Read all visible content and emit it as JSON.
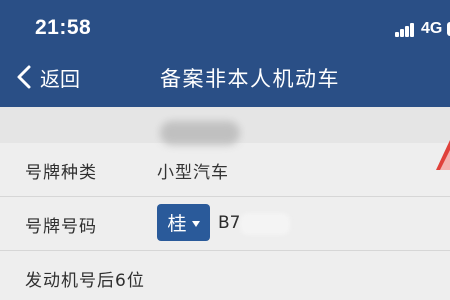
{
  "status_bar": {
    "time": "21:58",
    "network": "4G"
  },
  "nav": {
    "back_label": "返回",
    "title": "备案非本人机动车"
  },
  "form": {
    "plate_type": {
      "label": "号牌种类",
      "value": "小型汽车"
    },
    "plate_number": {
      "label": "号牌号码",
      "province": "桂",
      "value": "B7"
    },
    "engine_last6": {
      "label": "发动机号后6位"
    }
  },
  "colors": {
    "header_bg": "#2a4f86",
    "province_button_bg": "#2a5a9a",
    "page_bg": "#eeeeee",
    "accent_red": "#e0413a"
  },
  "icons": {
    "back": "chevron-left-icon",
    "caret": "caret-down-icon",
    "signal": "signal-bars-icon",
    "battery": "battery-icon"
  }
}
